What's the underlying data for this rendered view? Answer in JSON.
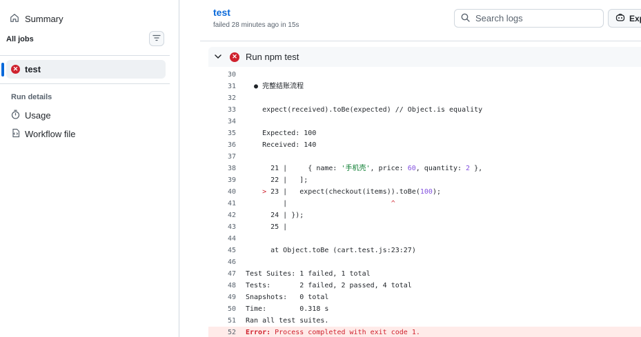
{
  "sidebar": {
    "summary_label": "Summary",
    "all_jobs_label": "All jobs",
    "job": {
      "name": "test",
      "status": "failed"
    },
    "run_details_label": "Run details",
    "links": [
      {
        "label": "Usage",
        "icon": "stopwatch-icon"
      },
      {
        "label": "Workflow file",
        "icon": "file-code-icon"
      }
    ]
  },
  "header": {
    "title": "test",
    "subtitle": "failed 28 minutes ago in 15s",
    "search_placeholder": "Search logs",
    "explore_label": "Exp"
  },
  "step": {
    "label": "Run npm test",
    "status": "failed"
  },
  "log_lines": [
    {
      "n": "30",
      "text": ""
    },
    {
      "n": "31",
      "text": "  ● 完整结账流程"
    },
    {
      "n": "32",
      "text": ""
    },
    {
      "n": "33",
      "text": "    expect(received).toBe(expected) // Object.is equality"
    },
    {
      "n": "34",
      "text": ""
    },
    {
      "n": "35",
      "text": "    Expected: 100"
    },
    {
      "n": "36",
      "text": "    Received: 140"
    },
    {
      "n": "37",
      "text": ""
    },
    {
      "n": "38",
      "pre": "      21 |     { name: ",
      "s1": "'手机壳'",
      "m1": ", price: ",
      "v1": "60",
      "m2": ", quantity: ",
      "v2": "2",
      "post": " },"
    },
    {
      "n": "39",
      "text": "      22 |   ];"
    },
    {
      "n": "40",
      "mark": "    > ",
      "pre": "23 |   expect(checkout(items)).toBe(",
      "v1": "100",
      "post": ");"
    },
    {
      "n": "41",
      "pre": "         |                         ",
      "caret": "^"
    },
    {
      "n": "42",
      "text": "      24 | });"
    },
    {
      "n": "43",
      "text": "      25 |"
    },
    {
      "n": "44",
      "text": ""
    },
    {
      "n": "45",
      "text": "      at Object.toBe (cart.test.js:23:27)"
    },
    {
      "n": "46",
      "text": ""
    },
    {
      "n": "47",
      "text": "Test Suites: 1 failed, 1 total"
    },
    {
      "n": "48",
      "text": "Tests:       2 failed, 2 passed, 4 total"
    },
    {
      "n": "49",
      "text": "Snapshots:   0 total"
    },
    {
      "n": "50",
      "text": "Time:        0.318 s"
    },
    {
      "n": "51",
      "text": "Ran all test suites."
    },
    {
      "n": "52",
      "err_label": "Error:",
      "err_text": " Process completed with exit code 1."
    }
  ],
  "colors": {
    "accent": "#0969da",
    "error": "#cf222e",
    "error_bg": "#ffebe9",
    "string": "#0a7c2f",
    "number": "#8250df"
  }
}
